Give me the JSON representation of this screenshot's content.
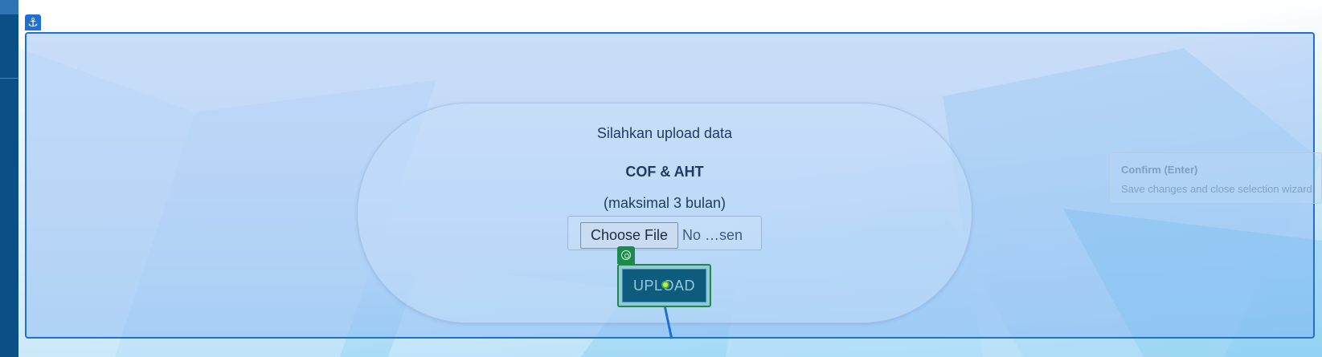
{
  "overlay": {
    "anchor_icon": "anchor-icon",
    "target_icon": "target-icon",
    "accent": "#1f6fd6",
    "target_color": "#1b8a4b"
  },
  "card": {
    "title": "Silahkan upload data",
    "subject": "COF & AHT",
    "note": "(maksimal 3 bulan)",
    "choose_file_label": "Choose File",
    "file_status": "No …sen",
    "upload_label": "UPLOAD"
  },
  "tooltip": {
    "title": "Confirm (Enter)",
    "description": "Save changes and close selection wizard."
  }
}
